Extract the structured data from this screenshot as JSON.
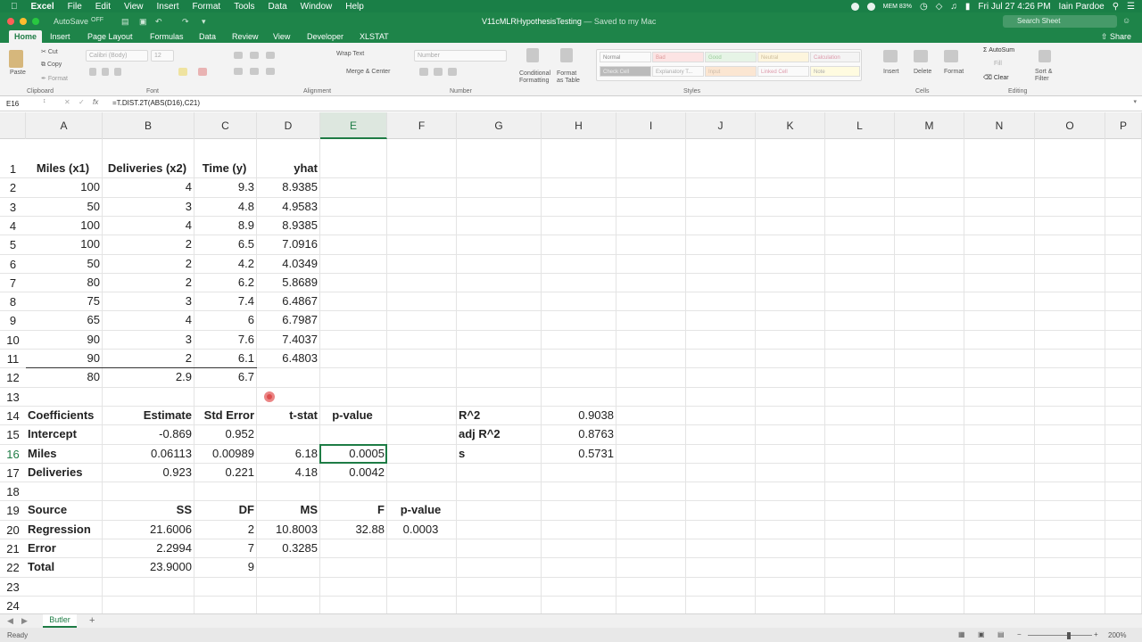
{
  "menubar": {
    "app": "Excel",
    "items": [
      "File",
      "Edit",
      "View",
      "Insert",
      "Format",
      "Tools",
      "Data",
      "Window",
      "Help"
    ],
    "mem": "MEM 83%",
    "clock": "Fri Jul 27  4:26 PM",
    "user": "Iain Pardoe"
  },
  "titlebar": {
    "autosave": "AutoSave",
    "autosave_state": "OFF",
    "doc": "V11cMLRHypothesisTesting",
    "saved": " — Saved to my Mac",
    "search_placeholder": "Search Sheet"
  },
  "tabs": [
    "Home",
    "Insert",
    "Page Layout",
    "Formulas",
    "Data",
    "Review",
    "View",
    "Developer",
    "XLSTAT"
  ],
  "share": "Share",
  "ribbon": {
    "paste": "Paste",
    "cut": "Cut",
    "copy": "Copy",
    "format": "Format",
    "font_name": "Calibri (Body)",
    "font_size": "12",
    "wrap": "Wrap Text",
    "merge": "Merge & Center",
    "numfmt": "Number",
    "cond": "Conditional Formatting",
    "fmt_table": "Format as Table",
    "insert": "Insert",
    "delete": "Delete",
    "format_cells": "Format",
    "autosum": "AutoSum",
    "fill": "Fill",
    "clear": "Clear",
    "sort": "Sort & Filter",
    "groups": {
      "clipboard": "Clipboard",
      "font": "Font",
      "alignment": "Alignment",
      "number": "Number",
      "styles": "Styles",
      "cells": "Cells",
      "editing": "Editing"
    },
    "styles": [
      "Normal",
      "Bad",
      "Good",
      "Neutral",
      "Calculation",
      "Check Cell",
      "Explanatory T...",
      "Input",
      "Linked Cell",
      "Note"
    ]
  },
  "formula_bar": {
    "name": "E16",
    "fx": "fx",
    "formula": "=T.DIST.2T(ABS(D16),C21)"
  },
  "columns": [
    "A",
    "B",
    "C",
    "D",
    "E",
    "F",
    "G",
    "H",
    "I",
    "J",
    "K",
    "L",
    "M",
    "N",
    "O",
    "P"
  ],
  "rows": [
    "1",
    "2",
    "3",
    "4",
    "5",
    "6",
    "7",
    "8",
    "9",
    "10",
    "11",
    "12",
    "13",
    "14",
    "15",
    "16",
    "17",
    "18",
    "19",
    "20",
    "21",
    "22",
    "23",
    "24"
  ],
  "cells": {
    "A1": "Miles (x1)",
    "B1": "Deliveries (x2)",
    "C1": "Time (y)",
    "D1": "yhat",
    "A2": "100",
    "B2": "4",
    "C2": "9.3",
    "D2": "8.9385",
    "A3": "50",
    "B3": "3",
    "C3": "4.8",
    "D3": "4.9583",
    "A4": "100",
    "B4": "4",
    "C4": "8.9",
    "D4": "8.9385",
    "A5": "100",
    "B5": "2",
    "C5": "6.5",
    "D5": "7.0916",
    "A6": "50",
    "B6": "2",
    "C6": "4.2",
    "D6": "4.0349",
    "A7": "80",
    "B7": "2",
    "C7": "6.2",
    "D7": "5.8689",
    "A8": "75",
    "B8": "3",
    "C8": "7.4",
    "D8": "6.4867",
    "A9": "65",
    "B9": "4",
    "C9": "6",
    "D9": "6.7987",
    "A10": "90",
    "B10": "3",
    "C10": "7.6",
    "D10": "7.4037",
    "A11": "90",
    "B11": "2",
    "C11": "6.1",
    "D11": "6.4803",
    "A12": "80",
    "B12": "2.9",
    "C12": "6.7",
    "A14": "Coefficients",
    "B14": "Estimate",
    "C14": "Std Error",
    "D14": "t-stat",
    "E14": "p-value",
    "G14": "R^2",
    "H14": "0.9038",
    "A15": "Intercept",
    "B15": "-0.869",
    "C15": "0.952",
    "G15": "adj R^2",
    "H15": "0.8763",
    "A16": "Miles",
    "B16": "0.06113",
    "C16": "0.00989",
    "D16": "6.18",
    "E16": "0.0005",
    "G16": "s",
    "H16": "0.5731",
    "A17": "Deliveries",
    "B17": "0.923",
    "C17": "0.221",
    "D17": "4.18",
    "E17": "0.0042",
    "A19": "Source",
    "B19": "SS",
    "C19": "DF",
    "D19": "MS",
    "E19": "F",
    "F19": "p-value",
    "A20": "Regression",
    "B20": "21.6006",
    "C20": "2",
    "D20": "10.8003",
    "E20": "32.88",
    "F20": "0.0003",
    "A21": "Error",
    "B21": "2.2994",
    "C21": "7",
    "D21": "0.3285",
    "A22": "Total",
    "B22": "23.9000",
    "C22": "9"
  },
  "sheet": {
    "name": "Butler",
    "add": "+"
  },
  "status": {
    "ready": "Ready",
    "zoom": "200%"
  },
  "accent": "#1e7c45"
}
